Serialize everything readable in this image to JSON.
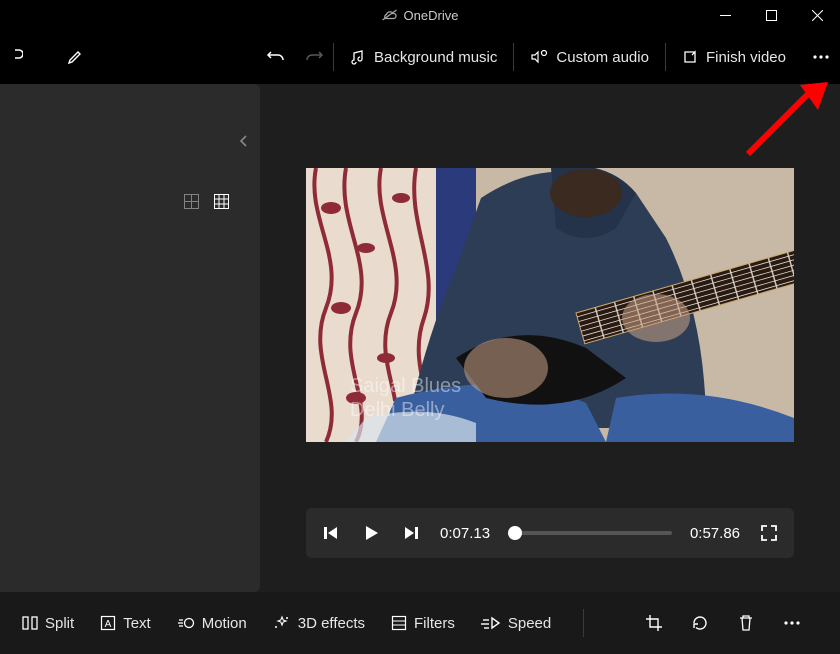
{
  "titlebar": {
    "onedrive_label": "OneDrive"
  },
  "topbar": {
    "bgmusic_label": "Background music",
    "custom_audio_label": "Custom audio",
    "finish_label": "Finish video"
  },
  "watermark": {
    "line1": "Saigal Blues",
    "line2": "Delhi Belly"
  },
  "playback": {
    "current": "0:07.13",
    "total": "0:57.86"
  },
  "bottom": {
    "split": "Split",
    "text": "Text",
    "motion": "Motion",
    "effects": "3D effects",
    "filters": "Filters",
    "speed": "Speed"
  }
}
